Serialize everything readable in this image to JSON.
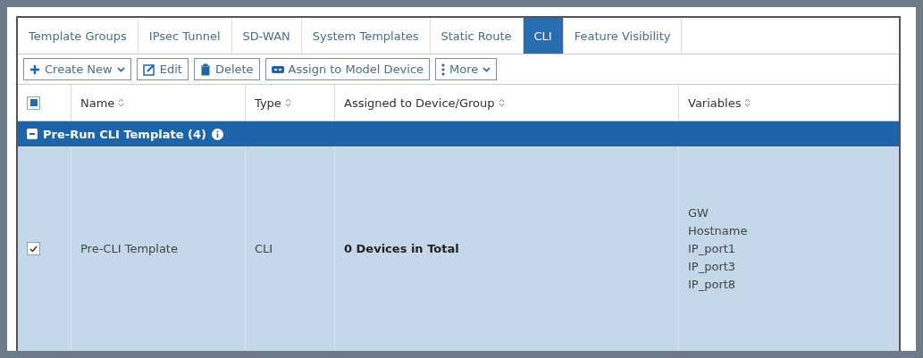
{
  "tabs": [
    {
      "label": "Template Groups",
      "selected": false
    },
    {
      "label": "IPsec Tunnel",
      "selected": false
    },
    {
      "label": "SD-WAN",
      "selected": false
    },
    {
      "label": "System Templates",
      "selected": false
    },
    {
      "label": "Static Route",
      "selected": false
    },
    {
      "label": "CLI",
      "selected": true
    },
    {
      "label": "Feature Visibility",
      "selected": false
    }
  ],
  "toolbar": [
    {
      "label": "Create New",
      "kind": "plus",
      "dropdown": true
    },
    {
      "label": "Edit",
      "kind": "edit",
      "dropdown": false
    },
    {
      "label": "Delete",
      "kind": "trash",
      "dropdown": false
    },
    {
      "label": "Assign to Model Device",
      "kind": "device",
      "dropdown": false
    },
    {
      "label": "More",
      "kind": "dots",
      "dropdown": true
    }
  ],
  "table": {
    "select_all": {
      "partial": true
    },
    "columns": [
      "Name",
      "Type",
      "Assigned to Device/Group",
      "Variables"
    ],
    "groups": [
      {
        "label": "Pre-Run CLI Template (4)",
        "expanded": true,
        "rows": [
          {
            "checked": true,
            "name": "Pre-CLI Template",
            "type": "CLI",
            "assigned": "0 Devices in Total",
            "variables": [
              "GW",
              "Hostname",
              "IP_port1",
              "IP_port3",
              "IP_port8"
            ]
          }
        ]
      }
    ]
  }
}
